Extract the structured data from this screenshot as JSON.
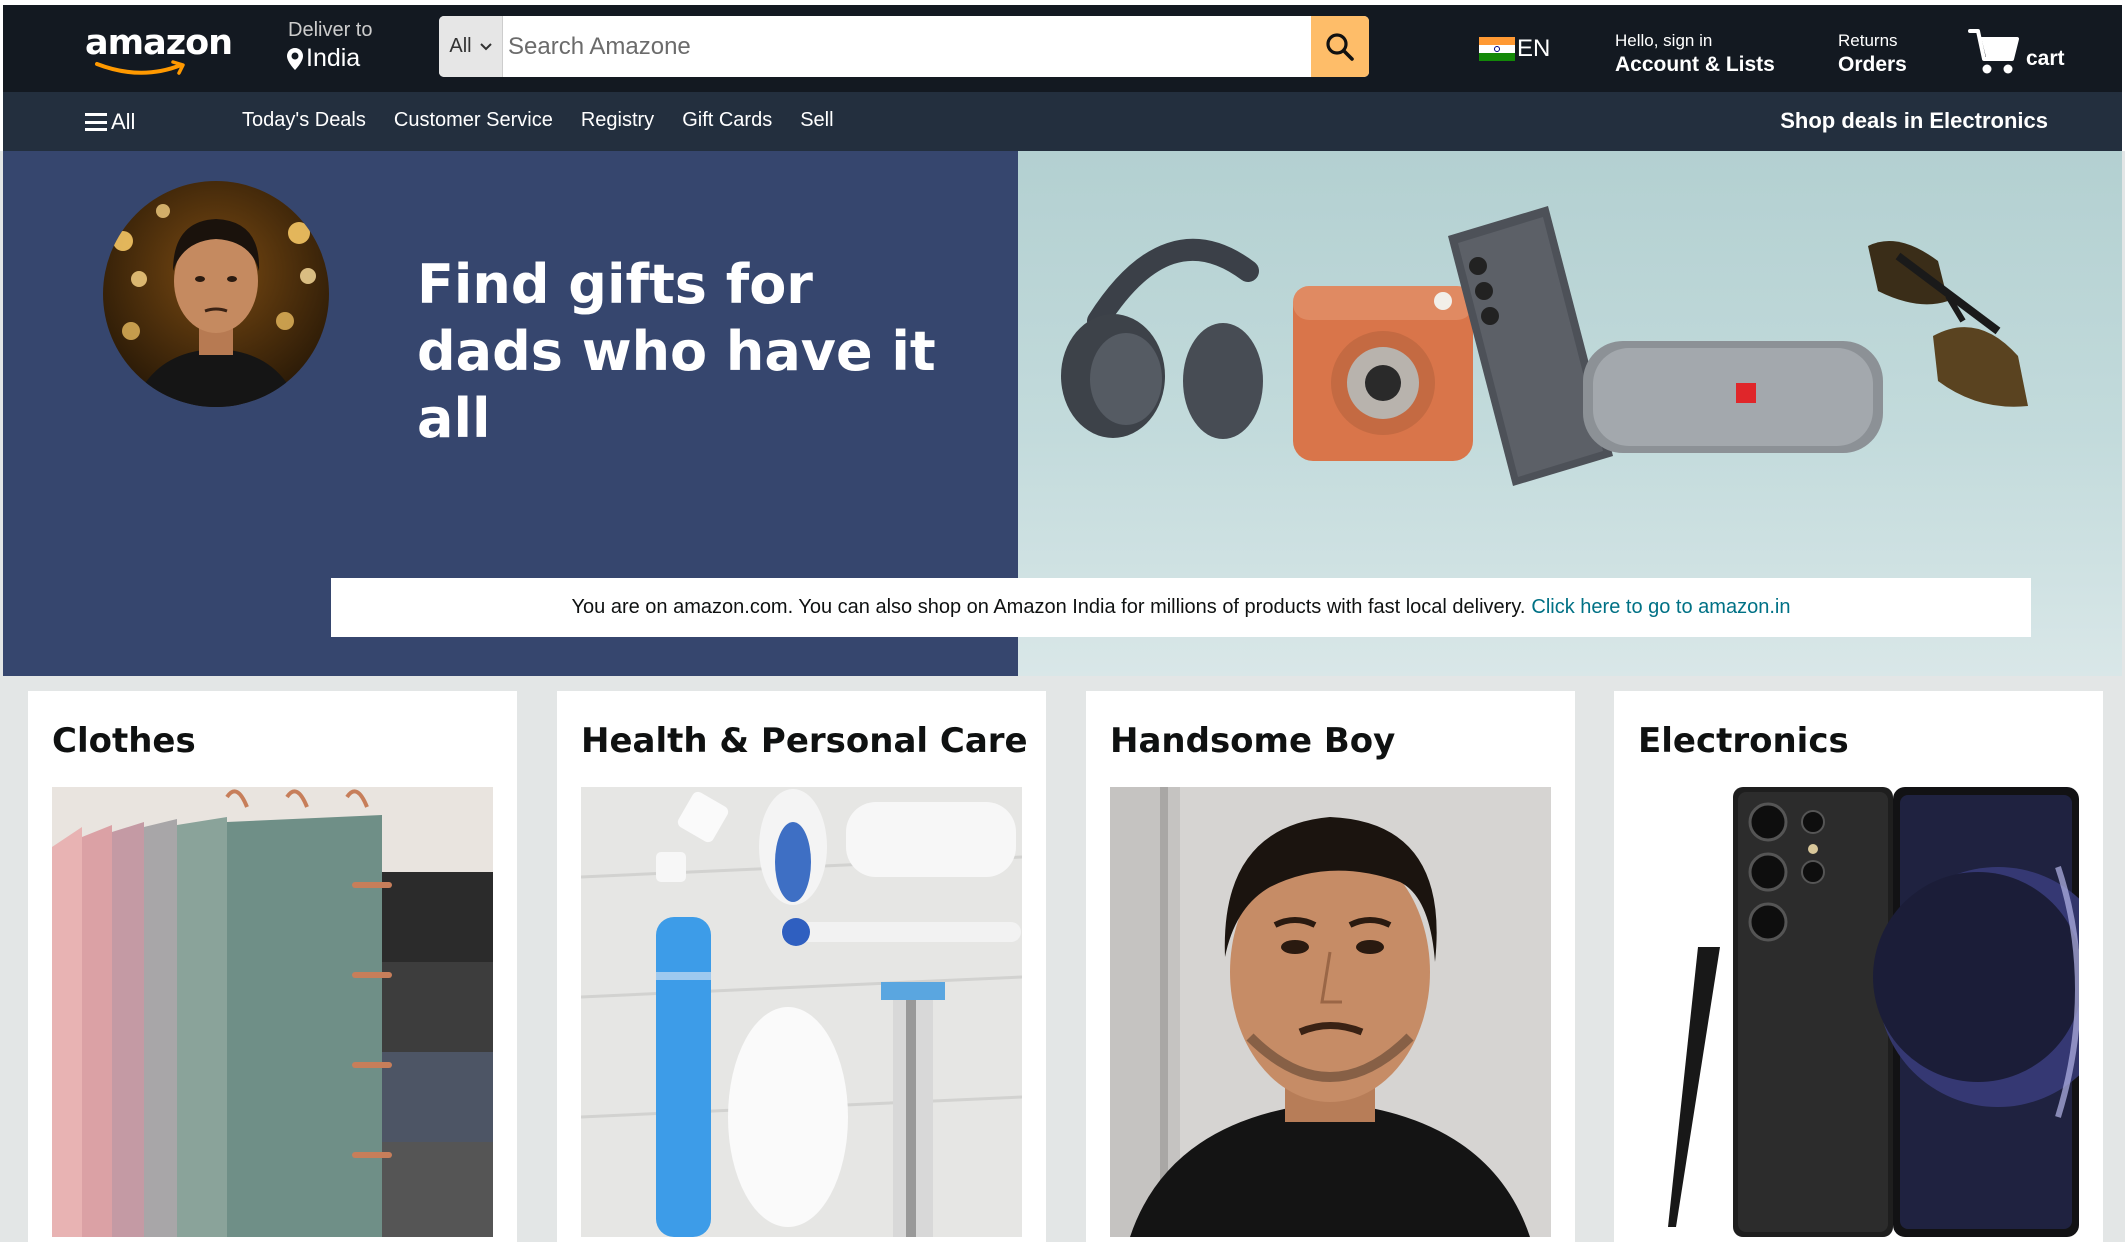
{
  "header": {
    "logo_text": "amazon",
    "deliver_label": "Deliver to",
    "deliver_location": "India",
    "search": {
      "category": "All",
      "placeholder": "Search Amazone"
    },
    "language": "EN",
    "account_greeting": "Hello, sign in",
    "account_label": "Account & Lists",
    "returns_label": "Returns",
    "orders_label": "Orders",
    "cart_label": "cart",
    "icons": {
      "search": "search-icon",
      "cart": "cart-icon",
      "location": "location-pin-icon",
      "flag": "india-flag-icon"
    }
  },
  "subnav": {
    "all_label": "All",
    "links": [
      "Today's Deals",
      "Customer Service",
      "Registry",
      "Gift Cards",
      "Sell"
    ],
    "promo": "Shop deals in Electronics"
  },
  "hero": {
    "heading_line1": "Find gifts for",
    "heading_line2": "dads who have it all",
    "notice_text": "You are on amazon.com. You can also shop on Amazon India for millions of products with fast local delivery.",
    "notice_link": "Click here to go to amazon.in"
  },
  "cards": [
    {
      "title": "Clothes"
    },
    {
      "title": "Health & Personal Care"
    },
    {
      "title": "Handsome Boy"
    },
    {
      "title": "Electronics"
    }
  ],
  "colors": {
    "nav_bg": "#131921",
    "subnav_bg": "#232f3e",
    "search_button": "#febd69",
    "hero_left": "#36466e",
    "link": "#007185",
    "page_bg": "#e3e6e6"
  }
}
